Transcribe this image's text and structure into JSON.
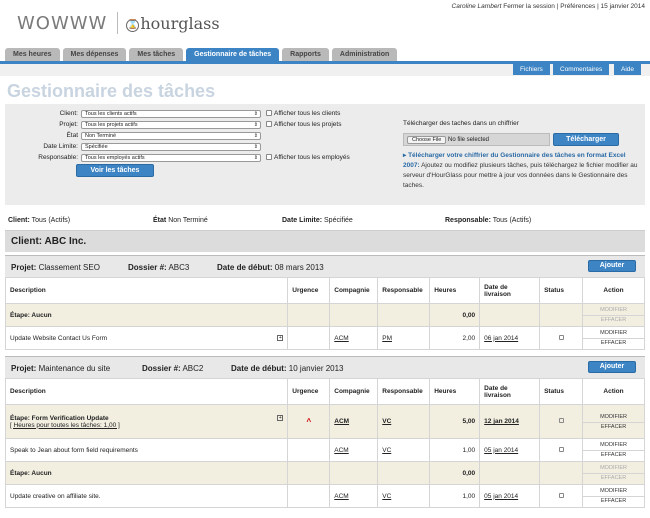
{
  "brand": {
    "logo_main": "WOWWW",
    "logo_secondary": "hourglass"
  },
  "userbar": {
    "user": "Caroline Lambert",
    "logout": "Fermer la session",
    "prefs": "Préférences",
    "date": "15 janvier 2014"
  },
  "tabs": [
    "Mes heures",
    "Mes dépenses",
    "Mes tâches",
    "Gestionnaire de tâches",
    "Rapports",
    "Administration"
  ],
  "subnav": [
    "Fichiers",
    "Commentaires",
    "Aide"
  ],
  "page_title": "Gestionnaire des tâches",
  "filters": {
    "client": {
      "label": "Client:",
      "value": "Tous les clients actifs",
      "check": "Afficher tous les clients"
    },
    "projet": {
      "label": "Projet:",
      "value": "Tous les projets actifs",
      "check": "Afficher tous les projets"
    },
    "etat": {
      "label": "État",
      "value": "Non Terminé"
    },
    "date": {
      "label": "Date Limite:",
      "value": "Spécifiée"
    },
    "responsable": {
      "label": "Responsable:",
      "value": "Tous les employés actifs",
      "check": "Afficher tous les employés"
    },
    "submit": "Voir les tâches"
  },
  "upload": {
    "label": "Télécharger des taches dans un chiffrier",
    "choose": "Choose File",
    "nofile": "No file selected",
    "button": "Télécharger",
    "link": "Télécharger votre chiffrier du Gestionnaire des tâches en format Excel 2007:",
    "text": "Ajoutez ou modifiez plusieurs tâches, puis téléchargez le fichier modifier au serveur d'HourGlass pour mettre à jour vos données dans le Gestionnaire des taches."
  },
  "summary": {
    "client_label": "Client:",
    "client_value": "Tous (Actifs)",
    "etat_label": "État",
    "etat_value": "Non Terminé",
    "date_label": "Date Limite:",
    "date_value": "Spécifiée",
    "resp_label": "Responsable:",
    "resp_value": "Tous (Actifs)"
  },
  "client_header": "Client: ABC Inc.",
  "columns": [
    "Description",
    "Urgence",
    "Compagnie",
    "Responsable",
    "Heures",
    "Date de livraison",
    "Status",
    "Action"
  ],
  "actions": {
    "modify": "MODIFIER",
    "delete": "EFFACER"
  },
  "add_label": "Ajouter",
  "projects": [
    {
      "projet_label": "Projet:",
      "projet": "Classement SEO",
      "dossier_label": "Dossier #:",
      "dossier": "ABC3",
      "date_label": "Date de début:",
      "date": "08 mars 2013",
      "rows": [
        {
          "type": "etape",
          "desc": "Étape: Aucun",
          "heures": "0,00"
        },
        {
          "type": "task",
          "desc": "Update Website Contact Us Form",
          "plus": true,
          "compagnie": "ACM",
          "resp": "PM",
          "heures": "2,00",
          "date": "06 jan 2014"
        }
      ]
    },
    {
      "projet_label": "Projet:",
      "projet": "Maintenance du site",
      "dossier_label": "Dossier #:",
      "dossier": "ABC2",
      "date_label": "Date de début:",
      "date": "10 janvier 2013",
      "rows": [
        {
          "type": "etape-task",
          "desc": "Étape: Form Verification Update",
          "sub": "[ Heures pour toutes les tâches: 1,00 ]",
          "plus": true,
          "urgence": "^",
          "compagnie": "ACM",
          "resp": "VC",
          "heures": "5,00",
          "date": "12 jan 2014"
        },
        {
          "type": "task",
          "desc": "Speak to Jean about form field requirements",
          "compagnie": "ACM",
          "resp": "VC",
          "heures": "1,00",
          "date": "05 jan 2014"
        },
        {
          "type": "etape",
          "desc": "Étape: Aucun",
          "heures": "0,00"
        },
        {
          "type": "task",
          "desc": "Update creative on affiliate site.",
          "compagnie": "ACM",
          "resp": "VC",
          "heures": "1,00",
          "date": "05 jan 2014"
        }
      ]
    }
  ]
}
